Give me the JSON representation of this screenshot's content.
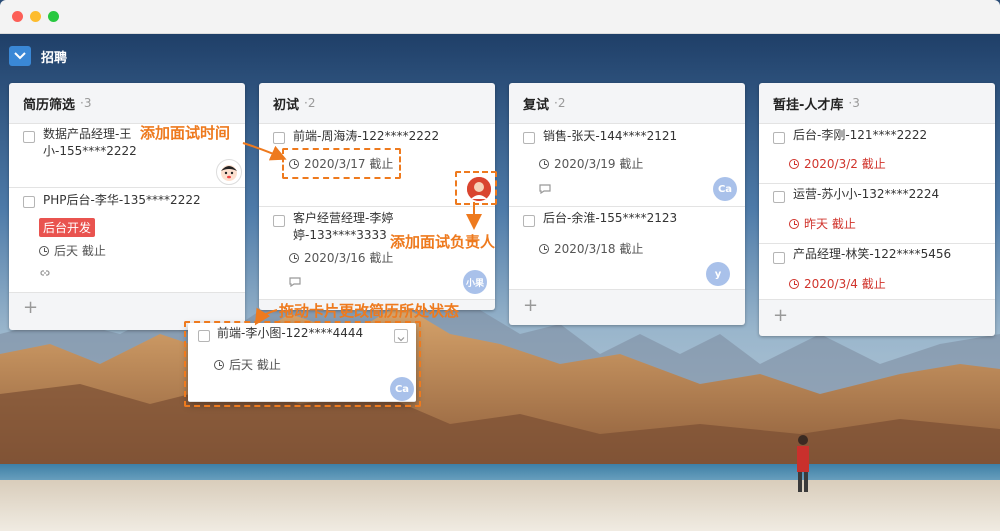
{
  "project": {
    "title": "招聘"
  },
  "columns": [
    {
      "name": "简历筛选",
      "count": "·3"
    },
    {
      "name": "初试",
      "count": "·2"
    },
    {
      "name": "复试",
      "count": "·2"
    },
    {
      "name": "暂挂-人才库",
      "count": "·3"
    }
  ],
  "cards": {
    "c1a": {
      "title_line1": "数据产品经理-王",
      "title_line2": "小-155****2222"
    },
    "c1b": {
      "title": "PHP后台-李华-135****2222",
      "tag": "后台开发",
      "due": "后天 截止"
    },
    "c2a": {
      "title": "前端-周海涛-122****2222",
      "due": "2020/3/17 截止"
    },
    "c2b": {
      "title_line1": "客户经营经理-李婷",
      "title_line2": "婷-133****3333",
      "due": "2020/3/16 截止",
      "avatar": "小果"
    },
    "c3a": {
      "title": "销售-张天-144****2121",
      "due": "2020/3/19 截止",
      "avatar": "Ca"
    },
    "c3b": {
      "title": "后台-余淮-155****2123",
      "due": "2020/3/18 截止",
      "avatar": "y"
    },
    "c4a": {
      "title": "后台-李刚-121****2222",
      "due": "2020/3/2 截止"
    },
    "c4b": {
      "title": "运营-苏小小-132****2224",
      "due": "昨天 截止"
    },
    "c4c": {
      "title": "产品经理-林笑-122****5456",
      "due": "2020/3/4 截止"
    },
    "drag": {
      "title": "前端-李小图-122****4444",
      "due": "后天 截止",
      "avatar": "Ca"
    }
  },
  "annotations": {
    "add_interview_time": "添加面试时间",
    "add_interviewer": "添加面试负责人",
    "drag_card": "拖动卡片更改简历所处状态"
  },
  "colors": {
    "accent": "#ee7a1e",
    "overdue": "#d0342c",
    "tag": "#e9534f",
    "brand": "#3a88d6"
  }
}
